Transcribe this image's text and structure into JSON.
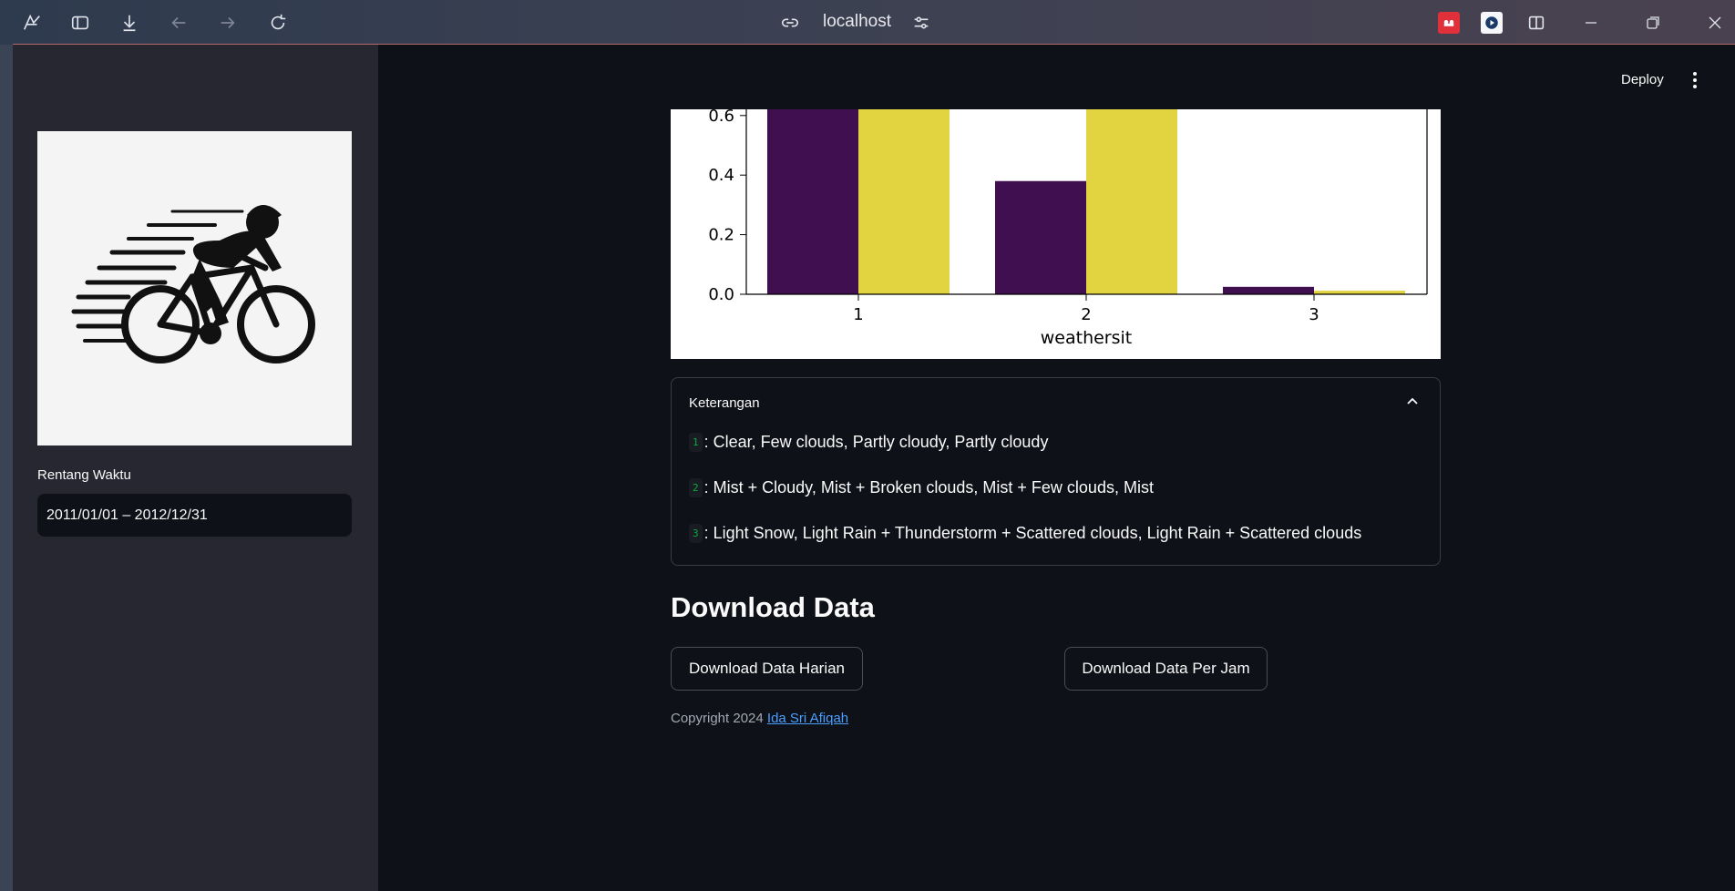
{
  "browser": {
    "url": "localhost",
    "colors": {
      "titlebar_start": "#2e3a4e",
      "titlebar_end": "#4a4150"
    }
  },
  "sidebar": {
    "logo_alt": "cyclist logo",
    "range_label": "Rentang Waktu",
    "range_value": "2011/01/01 – 2012/12/31"
  },
  "header": {
    "deploy_label": "Deploy"
  },
  "chart_data": {
    "type": "bar",
    "categories": [
      "1",
      "2",
      "3"
    ],
    "series": [
      {
        "color": "#3f0f4f",
        "values": [
          0.65,
          0.38,
          0.025
        ]
      },
      {
        "color": "#e2d441",
        "values": [
          0.65,
          0.65,
          0.012
        ]
      }
    ],
    "xlabel": "weathersit",
    "yticks": [
      "0.0",
      "0.2",
      "0.4",
      "0.6"
    ],
    "ylim_visible": [
      0,
      0.62
    ]
  },
  "expander": {
    "title": "Keterangan",
    "items": [
      {
        "code": "1",
        "text": ": Clear, Few clouds, Partly cloudy, Partly cloudy"
      },
      {
        "code": "2",
        "text": ": Mist + Cloudy, Mist + Broken clouds, Mist + Few clouds, Mist"
      },
      {
        "code": "3",
        "text": ": Light Snow, Light Rain + Thunderstorm + Scattered clouds, Light Rain + Scattered clouds"
      }
    ]
  },
  "download": {
    "heading": "Download Data",
    "daily_label": "Download Data Harian",
    "hourly_label": "Download Data Per Jam"
  },
  "footer": {
    "copyright": "Copyright 2024",
    "author": "Ida Sri Afiqah"
  }
}
